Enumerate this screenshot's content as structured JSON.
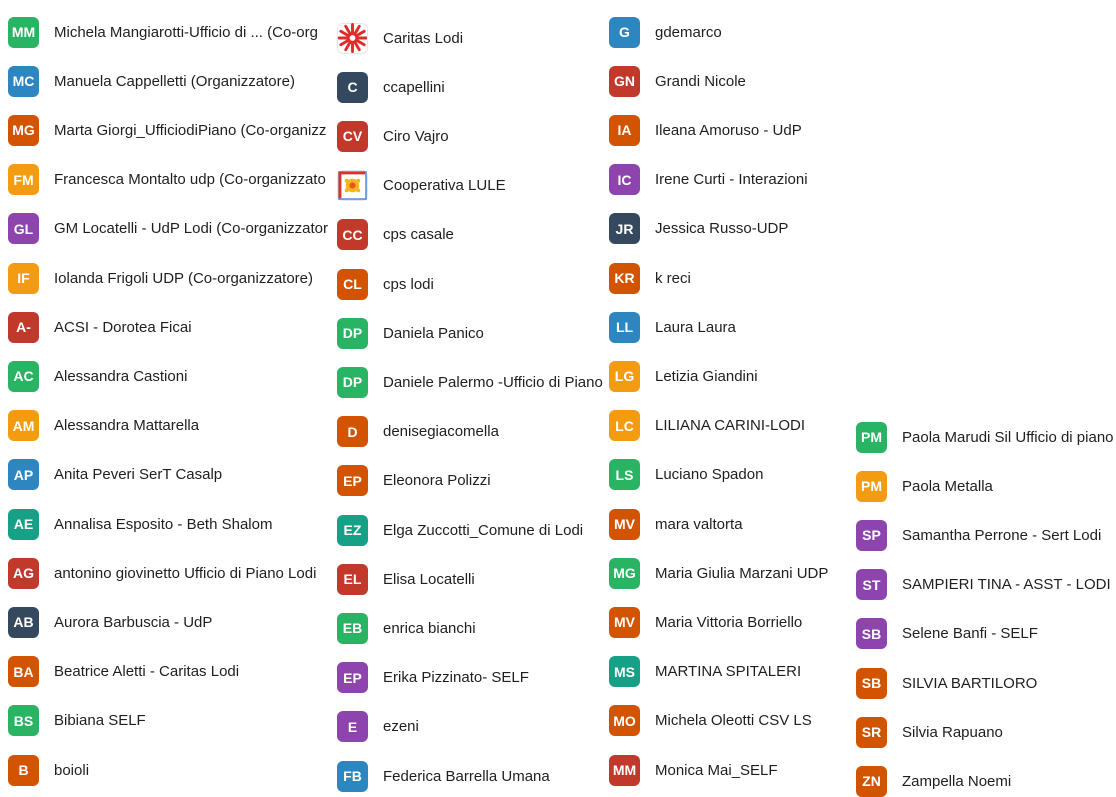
{
  "colors": {
    "green": "#28b463",
    "blue": "#2e86c1",
    "orange_red": "#d35400",
    "amber": "#f39c12",
    "purple": "#8e44ad",
    "red": "#c0392b",
    "teal": "#16a085",
    "navy": "#34495e"
  },
  "columns": [
    {
      "entries": [
        {
          "initials": "MM",
          "name": "Michela Mangiarotti-Ufficio di ... (Co-org",
          "color": "#28b463"
        },
        {
          "initials": "MC",
          "name": "Manuela Cappelletti (Organizzatore)",
          "color": "#2e86c1"
        },
        {
          "initials": "MG",
          "name": "Marta Giorgi_UfficiodiPiano (Co-organizz",
          "color": "#d35400"
        },
        {
          "initials": "FM",
          "name": "Francesca Montalto udp (Co-organizzato",
          "color": "#f39c12"
        },
        {
          "initials": "GL",
          "name": "GM Locatelli - UdP Lodi (Co-organizzator",
          "color": "#8e44ad"
        },
        {
          "initials": "IF",
          "name": "Iolanda Frigoli UDP (Co-organizzatore)",
          "color": "#f39c12"
        },
        {
          "initials": "A-",
          "name": "ACSI - Dorotea Ficai",
          "color": "#c0392b"
        },
        {
          "initials": "AC",
          "name": "Alessandra Castioni",
          "color": "#28b463"
        },
        {
          "initials": "AM",
          "name": "Alessandra Mattarella",
          "color": "#f39c12"
        },
        {
          "initials": "AP",
          "name": "Anita Peveri SerT Casalp",
          "color": "#2e86c1"
        },
        {
          "initials": "AE",
          "name": "Annalisa Esposito - Beth Shalom",
          "color": "#16a085"
        },
        {
          "initials": "AG",
          "name": "antonino giovinetto Ufficio di Piano Lodi",
          "color": "#c0392b"
        },
        {
          "initials": "AB",
          "name": "Aurora Barbuscia - UdP",
          "color": "#34495e"
        },
        {
          "initials": "BA",
          "name": "Beatrice Aletti - Caritas Lodi",
          "color": "#d35400"
        },
        {
          "initials": "BS",
          "name": "Bibiana SELF",
          "color": "#28b463"
        },
        {
          "initials": "B",
          "name": "boioli",
          "color": "#d35400"
        }
      ]
    },
    {
      "entries": [
        {
          "initials": "",
          "icon": "caritas-logo-icon",
          "name": "Caritas Lodi",
          "color": "#e02b2b"
        },
        {
          "initials": "C",
          "name": "ccapellini",
          "color": "#34495e"
        },
        {
          "initials": "CV",
          "name": "Ciro Vajro",
          "color": "#c0392b"
        },
        {
          "initials": "",
          "icon": "lule-logo-icon",
          "name": "Cooperativa LULE",
          "color": "#f39c12"
        },
        {
          "initials": "CC",
          "name": "cps casale",
          "color": "#c0392b"
        },
        {
          "initials": "CL",
          "name": "cps lodi",
          "color": "#d35400"
        },
        {
          "initials": "DP",
          "name": "Daniela Panico",
          "color": "#28b463"
        },
        {
          "initials": "DP",
          "name": "Daniele Palermo -Ufficio di Piano",
          "color": "#28b463"
        },
        {
          "initials": "D",
          "name": "denisegiacomella",
          "color": "#d35400"
        },
        {
          "initials": "EP",
          "name": "Eleonora Polizzi",
          "color": "#d35400"
        },
        {
          "initials": "EZ",
          "name": "Elga Zuccotti_Comune di Lodi",
          "color": "#16a085"
        },
        {
          "initials": "EL",
          "name": "Elisa Locatelli",
          "color": "#c0392b"
        },
        {
          "initials": "EB",
          "name": "enrica bianchi",
          "color": "#28b463"
        },
        {
          "initials": "EP",
          "name": "Erika Pizzinato- SELF",
          "color": "#8e44ad"
        },
        {
          "initials": "E",
          "name": "ezeni",
          "color": "#8e44ad"
        },
        {
          "initials": "FB",
          "name": "Federica Barrella Umana",
          "color": "#2e86c1"
        }
      ]
    },
    {
      "entries": [
        {
          "initials": "G",
          "name": "gdemarco",
          "color": "#2e86c1"
        },
        {
          "initials": "GN",
          "name": "Grandi Nicole",
          "color": "#c0392b"
        },
        {
          "initials": "IA",
          "name": "Ileana Amoruso - UdP",
          "color": "#d35400"
        },
        {
          "initials": "IC",
          "name": "Irene Curti - Interazioni",
          "color": "#8e44ad"
        },
        {
          "initials": "JR",
          "name": "Jessica Russo-UDP",
          "color": "#34495e"
        },
        {
          "initials": "KR",
          "name": "k reci",
          "color": "#d35400"
        },
        {
          "initials": "LL",
          "name": "Laura Laura",
          "color": "#2e86c1"
        },
        {
          "initials": "LG",
          "name": "Letizia Giandini",
          "color": "#f39c12"
        },
        {
          "initials": "LC",
          "name": "LILIANA CARINI-LODI",
          "color": "#f39c12"
        },
        {
          "initials": "LS",
          "name": "Luciano Spadon",
          "color": "#28b463"
        },
        {
          "initials": "MV",
          "name": "mara valtorta",
          "color": "#d35400"
        },
        {
          "initials": "MG",
          "name": "Maria Giulia Marzani UDP",
          "color": "#28b463"
        },
        {
          "initials": "MV",
          "name": "Maria Vittoria Borriello",
          "color": "#d35400"
        },
        {
          "initials": "MS",
          "name": "MARTINA SPITALERI",
          "color": "#16a085"
        },
        {
          "initials": "MO",
          "name": "Michela Oleotti CSV LS",
          "color": "#d35400"
        },
        {
          "initials": "MM",
          "name": "Monica Mai_SELF",
          "color": "#c0392b"
        }
      ]
    },
    {
      "entries": [
        {
          "initials": "PM",
          "name": "Paola Marudi Sil Ufficio di piano",
          "color": "#28b463"
        },
        {
          "initials": "PM",
          "name": "Paola Metalla",
          "color": "#f39c12"
        },
        {
          "initials": "SP",
          "name": "Samantha Perrone - Sert Lodi",
          "color": "#8e44ad"
        },
        {
          "initials": "ST",
          "name": "SAMPIERI TINA - ASST - LODI",
          "color": "#8e44ad"
        },
        {
          "initials": "SB",
          "name": "Selene Banfi - SELF",
          "color": "#8e44ad"
        },
        {
          "initials": "SB",
          "name": "SILVIA BARTILORO",
          "color": "#d35400"
        },
        {
          "initials": "SR",
          "name": "Silvia Rapuano",
          "color": "#d35400"
        },
        {
          "initials": "ZN",
          "name": "Zampella Noemi",
          "color": "#d35400"
        }
      ]
    }
  ]
}
